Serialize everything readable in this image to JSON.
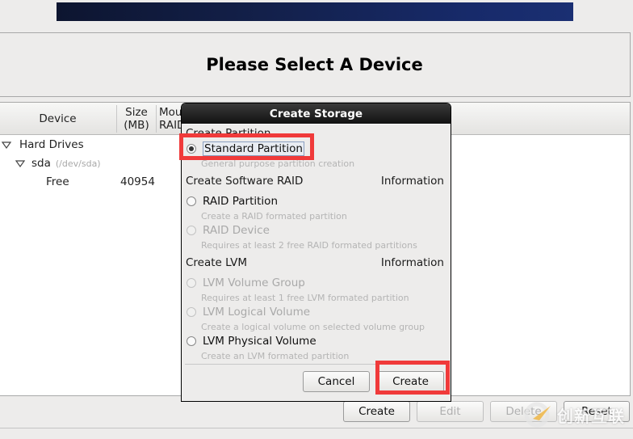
{
  "header": {
    "title": "Please Select A Device"
  },
  "device_tree": {
    "columns": [
      "Device",
      "Size\n(MB)",
      "Mou\nRAID"
    ],
    "column_device": "Device",
    "column_size_line1": "Size",
    "column_size_line2": "(MB)",
    "column_mount_line1": "Mou",
    "column_mount_line2": "RAID",
    "rows": [
      {
        "label": "Hard Drives",
        "level": 0,
        "expanded": true
      },
      {
        "label": "sda",
        "sublabel": "(/dev/sda)",
        "level": 1,
        "expanded": true
      },
      {
        "label": "Free",
        "size": "40954",
        "level": 2
      }
    ]
  },
  "bottom_buttons": {
    "create": "Create",
    "edit": "Edit",
    "delete": "Delete",
    "reset": "Reset"
  },
  "dialog": {
    "title": "Create Storage",
    "section_partition": "Create Partition",
    "section_raid": "Create Software RAID",
    "section_lvm": "Create LVM",
    "info_label": "Information",
    "options": [
      {
        "label": "Standard Partition",
        "description": "General purpose partition creation",
        "checked": true,
        "enabled": true
      },
      {
        "label": "RAID Partition",
        "description": "Create a RAID formated partition",
        "checked": false,
        "enabled": true
      },
      {
        "label": "RAID Device",
        "description": "Requires at least 2 free RAID formated partitions",
        "checked": false,
        "enabled": false
      },
      {
        "label": "LVM Volume Group",
        "description": "Requires at least 1 free LVM formated partition",
        "checked": false,
        "enabled": false
      },
      {
        "label": "LVM Logical Volume",
        "description": "Create a logical volume on selected volume group",
        "checked": false,
        "enabled": false
      },
      {
        "label": "LVM Physical Volume",
        "description": "Create an LVM formated partition",
        "checked": false,
        "enabled": true
      }
    ],
    "cancel_label": "Cancel",
    "create_label": "Create"
  },
  "annotation_color": "#f03a3a",
  "watermark": {
    "text": "创新互联"
  }
}
